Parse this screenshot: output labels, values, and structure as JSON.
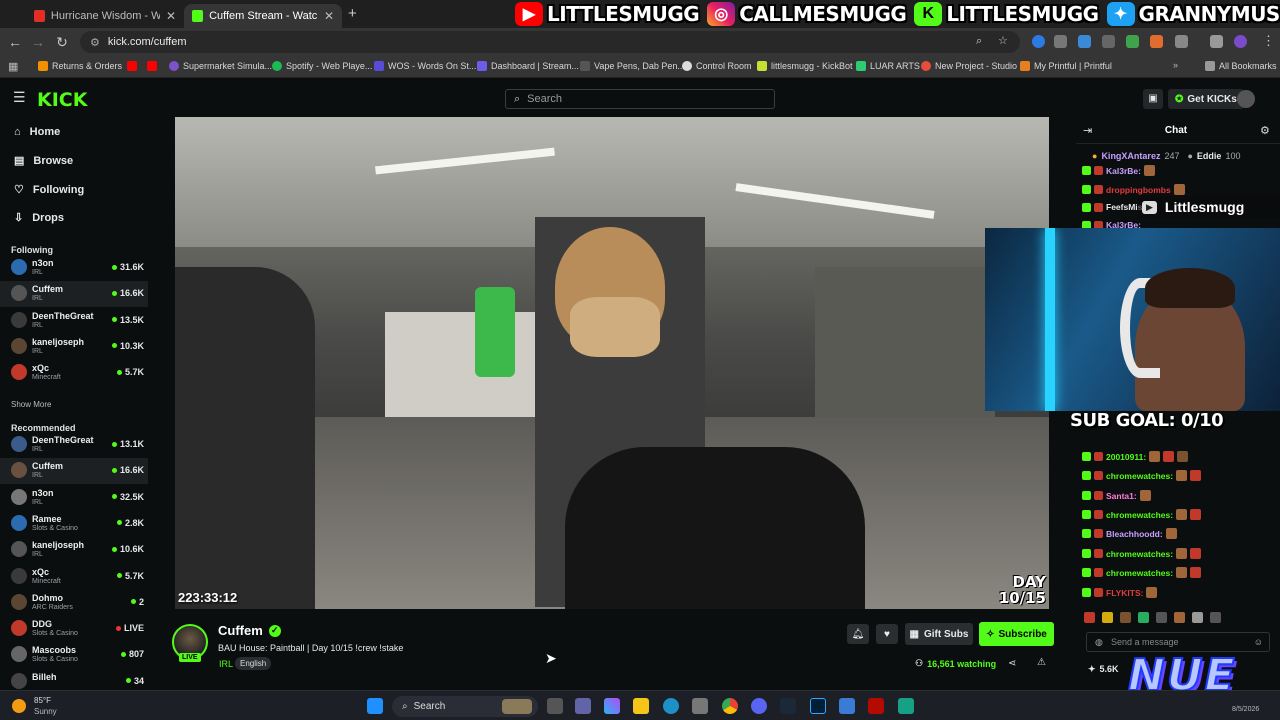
{
  "browser": {
    "tabs": [
      {
        "title": "Hurricane Wisdom - Woosah (C",
        "color": "#e52d27"
      },
      {
        "title": "Cuffem Stream - Watch Live",
        "color": "#53fc18"
      }
    ],
    "url": "kick.com/cuffem",
    "bookmarks": [
      "Returns & Orders",
      "Supermarket Simula...",
      "Spotify - Web Playe...",
      "WOS - Words On St...",
      "Dashboard | Stream...",
      "Vape Pens, Dab Pen...",
      "Control Room",
      "littlesmugg - KickBot",
      "LUAR ARTS",
      "New Project - Studio",
      "My Printful | Printful"
    ],
    "all_bookmarks": "All Bookmarks"
  },
  "banner": {
    "items": [
      {
        "icon": "youtube-icon",
        "text": "LITTLESMUGG"
      },
      {
        "icon": "instagram-icon",
        "text": "CALLMESMUGG"
      },
      {
        "icon": "kick-icon",
        "text": "LITTLESMUGG"
      },
      {
        "icon": "twitter-icon",
        "text": "GRANNYMUSLIM"
      }
    ]
  },
  "header": {
    "logo": "KICK",
    "search_placeholder": "Search",
    "get_kicks": "Get KICKs"
  },
  "sidebar": {
    "nav": [
      "Home",
      "Browse",
      "Following",
      "Drops"
    ],
    "following_title": "Following",
    "following": [
      {
        "name": "n3on",
        "category": "IRL",
        "viewers": "31.6K",
        "live": true
      },
      {
        "name": "Cuffem",
        "category": "IRL",
        "viewers": "16.6K",
        "live": true
      },
      {
        "name": "DeenTheGreat",
        "category": "IRL",
        "viewers": "13.5K",
        "live": true
      },
      {
        "name": "kaneljoseph",
        "category": "IRL",
        "viewers": "10.3K",
        "live": true
      },
      {
        "name": "xQc",
        "category": "Minecraft",
        "viewers": "5.7K",
        "live": true
      }
    ],
    "show_more": "Show More",
    "recommended_title": "Recommended",
    "recommended": [
      {
        "name": "DeenTheGreat",
        "category": "IRL",
        "viewers": "13.1K"
      },
      {
        "name": "Cuffem",
        "category": "IRL",
        "viewers": "16.6K"
      },
      {
        "name": "n3on",
        "category": "IRL",
        "viewers": "32.5K"
      },
      {
        "name": "Ramee",
        "category": "Slots & Casino",
        "viewers": "2.8K"
      },
      {
        "name": "kaneljoseph",
        "category": "IRL",
        "viewers": "10.6K"
      },
      {
        "name": "xQc",
        "category": "Minecraft",
        "viewers": "5.7K"
      },
      {
        "name": "Dohmo",
        "category": "ARC Raiders",
        "viewers": "2"
      },
      {
        "name": "DDG",
        "category": "Slots & Casino",
        "viewers": "LIVE"
      },
      {
        "name": "Mascoobs",
        "category": "Slots & Casino",
        "viewers": "807"
      },
      {
        "name": "Billeh",
        "category": "",
        "viewers": "34"
      }
    ]
  },
  "video": {
    "timecode": "223:33:12",
    "day_line1": "DAY",
    "day_line2": "10/15"
  },
  "stream": {
    "streamer": "Cuffem",
    "live_badge": "LIVE",
    "title": "BAU House: Paintball | Day 10/15  !crew !stake",
    "category": "IRL",
    "language": "English",
    "gift_subs": "Gift Subs",
    "subscribe": "Subscribe",
    "watching": "16,561 watching"
  },
  "chat": {
    "title": "Chat",
    "pinned": [
      {
        "name": "KingXAntarez",
        "count": "247"
      },
      {
        "name": "Eddie",
        "count": "100"
      }
    ],
    "messages": [
      {
        "user": "Kal3rBe:",
        "color": "#c7a0ff",
        "emotes": 1
      },
      {
        "user": "droppingbombs",
        "color": "#e33b3b",
        "emotes": 1
      },
      {
        "user": "FeefsMis",
        "color": "#e8e8e8",
        "emotes": 0
      },
      {
        "user": "Kal3rBe:",
        "color": "#c7a0ff",
        "emotes": 0
      },
      {
        "user": "20010911:",
        "color": "#53fc18",
        "emotes": 3
      },
      {
        "user": "chromewatches:",
        "color": "#53fc18",
        "emotes": 2
      },
      {
        "user": "Santa1:",
        "color": "#ff7edb",
        "emotes": 1
      },
      {
        "user": "chromewatches:",
        "color": "#53fc18",
        "emotes": 2
      },
      {
        "user": "Bleachhoodd:",
        "color": "#c7a0ff",
        "emotes": 1
      },
      {
        "user": "chromewatches:",
        "color": "#53fc18",
        "emotes": 2
      },
      {
        "user": "chromewatches:",
        "color": "#53fc18",
        "emotes": 2
      },
      {
        "user": "FLYKITS:",
        "color": "#e33b3b",
        "emotes": 1
      }
    ],
    "input_placeholder": "Send a message",
    "kicks_count": "5.6K"
  },
  "overlays": {
    "yt_label": "Littlesmugg",
    "sub_goal": "SUB GOAL: 0/10",
    "logo": "NUE"
  },
  "taskbar": {
    "weather_temp": "85°F",
    "weather_desc": "Sunny",
    "search": "Search",
    "date": "8/5/2026"
  },
  "colors": {
    "kick_green": "#53fc18",
    "bg": "#0b0e0f"
  }
}
